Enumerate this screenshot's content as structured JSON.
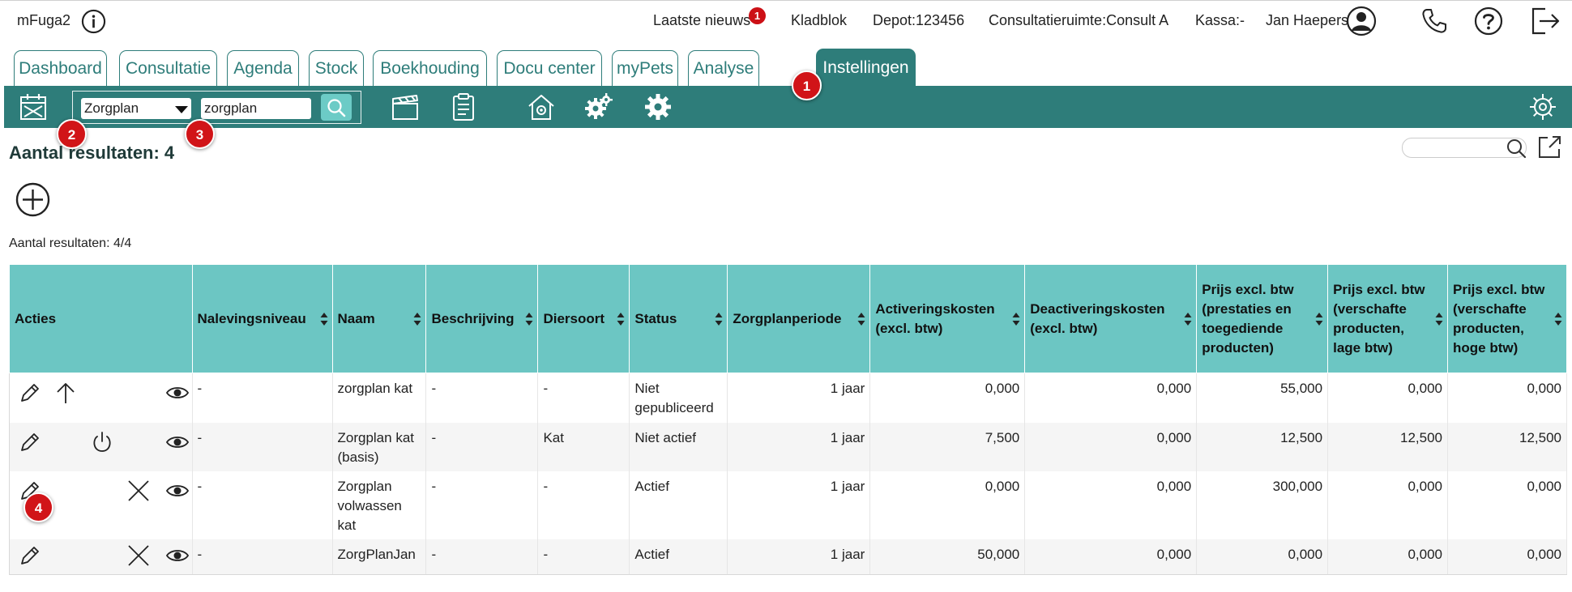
{
  "topbar": {
    "app_name": "mFuga2",
    "news": "Laatste nieuws",
    "news_count": "1",
    "notepad": "Kladblok",
    "depot": "Depot:123456",
    "consult_room": "Consultatieruimte:Consult A",
    "register": "Kassa:-",
    "user": "Jan Haepers"
  },
  "tabs": [
    {
      "label": "Dashboard"
    },
    {
      "label": "Consultatie"
    },
    {
      "label": "Agenda"
    },
    {
      "label": "Stock"
    },
    {
      "label": "Boekhouding"
    },
    {
      "label": "Docu center"
    },
    {
      "label": "myPets"
    },
    {
      "label": "Analyse"
    },
    {
      "label": "Instellingen"
    }
  ],
  "toolbar": {
    "select_value": "Zorgplan",
    "search_value": "zorgplan"
  },
  "markers": [
    "1",
    "2",
    "3",
    "4"
  ],
  "results_title": "Aantal resultaten: 4",
  "results_count": "Aantal resultaten: 4/4",
  "table": {
    "headers": [
      "Acties",
      "Nalevingsniveau",
      "Naam",
      "Beschrijving",
      "Diersoort",
      "Status",
      "Zorgplanperiode",
      "Activeringskosten (excl. btw)",
      "Deactiveringskosten (excl. btw)",
      "Prijs excl. btw (prestaties en toegediende producten)",
      "Prijs excl. btw (verschafte producten, lage btw)",
      "Prijs excl. btw (verschafte producten, hoge btw)"
    ],
    "rows": [
      {
        "nalevingsniveau": "-",
        "naam": "zorgplan kat",
        "beschrijving": "-",
        "diersoort": "-",
        "status": "Niet gepubliceerd",
        "periode": "1 jaar",
        "activering": "0,000",
        "deactivering": "0,000",
        "prijs_prestaties": "55,000",
        "prijs_laag": "0,000",
        "prijs_hoog": "0,000"
      },
      {
        "nalevingsniveau": "-",
        "naam": "Zorgplan kat (basis)",
        "beschrijving": "-",
        "diersoort": "Kat",
        "status": "Niet actief",
        "periode": "1 jaar",
        "activering": "7,500",
        "deactivering": "0,000",
        "prijs_prestaties": "12,500",
        "prijs_laag": "12,500",
        "prijs_hoog": "12,500"
      },
      {
        "nalevingsniveau": "-",
        "naam": "Zorgplan volwassen kat",
        "beschrijving": "-",
        "diersoort": "-",
        "status": "Actief",
        "periode": "1 jaar",
        "activering": "0,000",
        "deactivering": "0,000",
        "prijs_prestaties": "300,000",
        "prijs_laag": "0,000",
        "prijs_hoog": "0,000"
      },
      {
        "nalevingsniveau": "-",
        "naam": "ZorgPlanJan",
        "beschrijving": "-",
        "diersoort": "-",
        "status": "Actief",
        "periode": "1 jaar",
        "activering": "50,000",
        "deactivering": "0,000",
        "prijs_prestaties": "0,000",
        "prijs_laag": "0,000",
        "prijs_hoog": "0,000"
      }
    ]
  },
  "colors": {
    "brand": "#2e7d7a",
    "table_header": "#6cc6c3",
    "marker": "#d11418"
  },
  "icons": [
    "info-icon",
    "user-icon",
    "phone-icon",
    "help-icon",
    "logout-icon",
    "calendar-icon",
    "search-icon",
    "clapperboard-icon",
    "clipboard-icon",
    "clinic-icon",
    "gears-icon",
    "gear-icon",
    "settings-icon",
    "export-icon",
    "add-icon",
    "edit-icon",
    "up-arrow-icon",
    "power-icon",
    "close-icon",
    "eye-icon",
    "sort-icon"
  ]
}
